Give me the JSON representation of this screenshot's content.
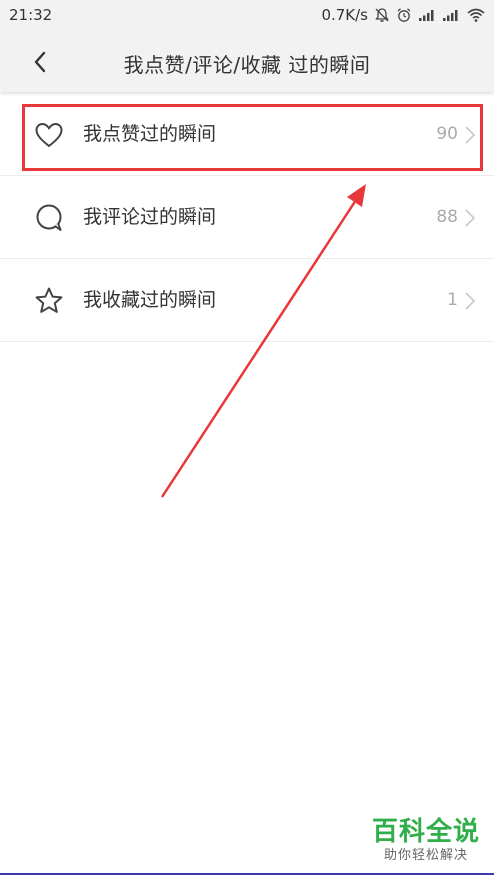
{
  "status_bar": {
    "time": "21:32",
    "net_speed": "0.7K/s"
  },
  "nav": {
    "title": "我点赞/评论/收藏 过的瞬间"
  },
  "list": {
    "items": [
      {
        "label": "我点赞过的瞬间",
        "count": "90",
        "icon": "heart-icon"
      },
      {
        "label": "我评论过的瞬间",
        "count": "88",
        "icon": "comment-bubble-icon"
      },
      {
        "label": "我收藏过的瞬间",
        "count": "1",
        "icon": "star-icon"
      }
    ]
  },
  "annotation": {
    "highlight_color": "#e8373a"
  },
  "watermark": {
    "main": "百科全说",
    "sub": "助你轻松解决",
    "color": "#2fae4a"
  }
}
